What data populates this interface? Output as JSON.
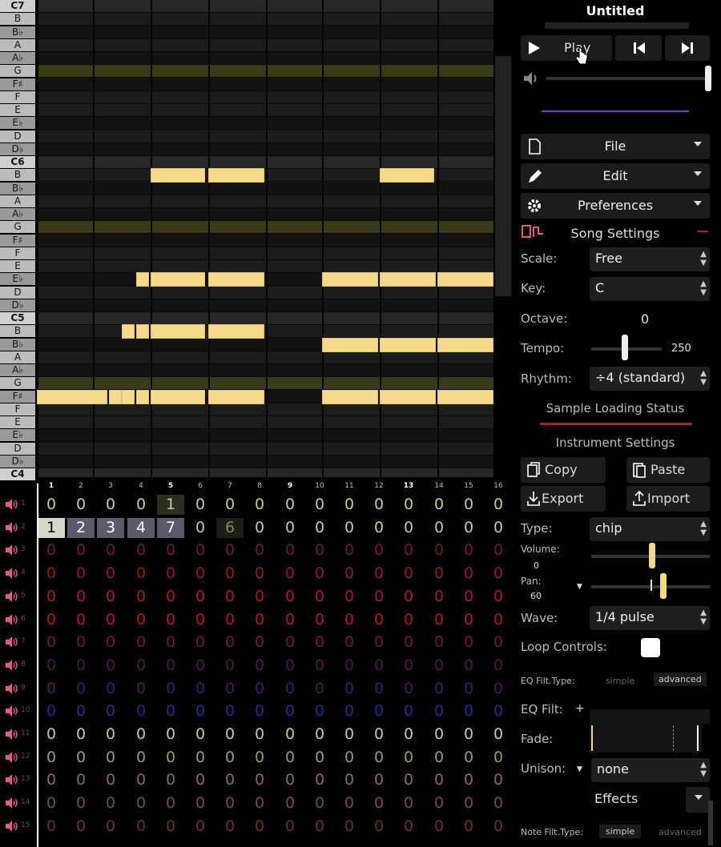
{
  "piano": {
    "keys": [
      {
        "label": "C7",
        "type": "oct"
      },
      {
        "label": "B",
        "type": "white"
      },
      {
        "label": "B♭",
        "type": "black"
      },
      {
        "label": "A",
        "type": "white"
      },
      {
        "label": "A♭",
        "type": "black"
      },
      {
        "label": "G",
        "type": "white"
      },
      {
        "label": "F♯",
        "type": "black"
      },
      {
        "label": "F",
        "type": "white"
      },
      {
        "label": "E",
        "type": "white"
      },
      {
        "label": "E♭",
        "type": "black"
      },
      {
        "label": "D",
        "type": "white"
      },
      {
        "label": "D♭",
        "type": "black"
      },
      {
        "label": "C6",
        "type": "oct"
      },
      {
        "label": "B",
        "type": "white"
      },
      {
        "label": "B♭",
        "type": "black"
      },
      {
        "label": "A",
        "type": "white"
      },
      {
        "label": "A♭",
        "type": "black"
      },
      {
        "label": "G",
        "type": "white"
      },
      {
        "label": "F♯",
        "type": "black"
      },
      {
        "label": "F",
        "type": "white"
      },
      {
        "label": "E",
        "type": "white"
      },
      {
        "label": "E♭",
        "type": "black"
      },
      {
        "label": "D",
        "type": "white"
      },
      {
        "label": "D♭",
        "type": "black"
      },
      {
        "label": "C5",
        "type": "oct"
      },
      {
        "label": "B",
        "type": "white"
      },
      {
        "label": "B♭",
        "type": "black"
      },
      {
        "label": "A",
        "type": "white"
      },
      {
        "label": "A♭",
        "type": "black"
      },
      {
        "label": "G",
        "type": "white"
      },
      {
        "label": "F♯",
        "type": "black"
      },
      {
        "label": "F",
        "type": "white"
      },
      {
        "label": "E",
        "type": "white"
      },
      {
        "label": "E♭",
        "type": "black"
      },
      {
        "label": "D",
        "type": "white"
      },
      {
        "label": "D♭",
        "type": "black"
      },
      {
        "label": "C4",
        "type": "oct"
      }
    ]
  },
  "pattern": {
    "bar_numbers": [
      "1",
      "2",
      "3",
      "4",
      "5",
      "6",
      "7",
      "8",
      "9",
      "10",
      "11",
      "12",
      "13",
      "14",
      "15",
      "16"
    ],
    "channels": [
      {
        "num": "1",
        "cells": [
          "0",
          "0",
          "0",
          "0",
          "1",
          "0",
          "0",
          "0",
          "0",
          "0",
          "0",
          "0",
          "0",
          "0",
          "0",
          "0"
        ],
        "color": "#c8c890"
      },
      {
        "num": "2",
        "cells": [
          "1",
          "2",
          "3",
          "4",
          "7",
          "0",
          "6",
          "0",
          "0",
          "0",
          "0",
          "0",
          "0",
          "0",
          "0",
          "0"
        ],
        "color": "#c8c890"
      },
      {
        "num": "3",
        "cells": [
          "0",
          "0",
          "0",
          "0",
          "0",
          "0",
          "0",
          "0",
          "0",
          "0",
          "0",
          "0",
          "0",
          "0",
          "0",
          "0"
        ],
        "color": "#6a2020"
      },
      {
        "num": "4",
        "cells": [
          "0",
          "0",
          "0",
          "0",
          "0",
          "0",
          "0",
          "0",
          "0",
          "0",
          "0",
          "0",
          "0",
          "0",
          "0",
          "0"
        ],
        "color": "#8a1c2a"
      },
      {
        "num": "5",
        "cells": [
          "0",
          "0",
          "0",
          "0",
          "0",
          "0",
          "0",
          "0",
          "0",
          "0",
          "0",
          "0",
          "0",
          "0",
          "0",
          "0"
        ],
        "color": "#a01c2e"
      },
      {
        "num": "6",
        "cells": [
          "0",
          "0",
          "0",
          "0",
          "0",
          "0",
          "0",
          "0",
          "0",
          "0",
          "0",
          "0",
          "0",
          "0",
          "0",
          "0"
        ],
        "color": "#b0182a"
      },
      {
        "num": "7",
        "cells": [
          "0",
          "0",
          "0",
          "0",
          "0",
          "0",
          "0",
          "0",
          "0",
          "0",
          "0",
          "0",
          "0",
          "0",
          "0",
          "0"
        ],
        "color": "#6a1c3a"
      },
      {
        "num": "8",
        "cells": [
          "0",
          "0",
          "0",
          "0",
          "0",
          "0",
          "0",
          "0",
          "0",
          "0",
          "0",
          "0",
          "0",
          "0",
          "0",
          "0"
        ],
        "color": "#4a1a4a"
      },
      {
        "num": "9",
        "cells": [
          "0",
          "0",
          "0",
          "0",
          "0",
          "0",
          "0",
          "0",
          "0",
          "0",
          "0",
          "0",
          "0",
          "0",
          "0",
          "0"
        ],
        "color": "#4a1a6a"
      },
      {
        "num": "10",
        "cells": [
          "0",
          "0",
          "0",
          "0",
          "0",
          "0",
          "0",
          "0",
          "0",
          "0",
          "0",
          "0",
          "0",
          "0",
          "0",
          "0"
        ],
        "color": "#2a2a8a"
      },
      {
        "num": "11",
        "cells": [
          "0",
          "0",
          "0",
          "0",
          "0",
          "0",
          "0",
          "0",
          "0",
          "0",
          "0",
          "0",
          "0",
          "0",
          "0",
          "0"
        ],
        "color": "#c8c890"
      },
      {
        "num": "12",
        "cells": [
          "0",
          "0",
          "0",
          "0",
          "0",
          "0",
          "0",
          "0",
          "0",
          "0",
          "0",
          "0",
          "0",
          "0",
          "0",
          "0"
        ],
        "color": "#a09870"
      },
      {
        "num": "13",
        "cells": [
          "0",
          "0",
          "0",
          "0",
          "0",
          "0",
          "0",
          "0",
          "0",
          "0",
          "0",
          "0",
          "0",
          "0",
          "0",
          "0"
        ],
        "color": "#8a6a5a"
      },
      {
        "num": "14",
        "cells": [
          "0",
          "0",
          "0",
          "0",
          "0",
          "0",
          "0",
          "0",
          "0",
          "0",
          "0",
          "0",
          "0",
          "0",
          "0",
          "0"
        ],
        "color": "#7a4a4a"
      },
      {
        "num": "15",
        "cells": [
          "0",
          "0",
          "0",
          "0",
          "0",
          "0",
          "0",
          "0",
          "0",
          "0",
          "0",
          "0",
          "0",
          "0",
          "0",
          "0"
        ],
        "color": "#6a3030"
      }
    ]
  },
  "panel": {
    "title": "Untitled",
    "play_label": "Play",
    "menus": {
      "file": "File",
      "edit": "Edit",
      "preferences": "Preferences"
    },
    "song_settings": "Song Settings",
    "scale_label": "Scale:",
    "scale_value": "Free",
    "key_label": "Key:",
    "key_value": "C",
    "octave_label": "Octave:",
    "octave_value": "0",
    "tempo_label": "Tempo:",
    "tempo_value": "250",
    "rhythm_label": "Rhythm:",
    "rhythm_value": "÷4 (standard)",
    "sample_status": "Sample Loading Status",
    "instrument_settings": "Instrument Settings",
    "copy_label": "Copy",
    "paste_label": "Paste",
    "export_label": "Export",
    "import_label": "Import",
    "type_label": "Type:",
    "type_value": "chip",
    "volume_label": "Volume:",
    "volume_value": "0",
    "pan_label": "Pan:",
    "pan_value": "60",
    "wave_label": "Wave:",
    "wave_value": "1/4 pulse",
    "loop_label": "Loop Controls:",
    "eq_type_label": "EQ Filt.Type:",
    "eq_simple": "simple",
    "eq_advanced": "advanced",
    "eq_filt_label": "EQ Filt:",
    "eq_add": "+",
    "fade_label": "Fade:",
    "unison_label": "Unison:",
    "unison_value": "none",
    "effects_label": "Effects",
    "note_type_label": "Note Filt.Type:",
    "note_simple": "simple",
    "note_advanced": "advanced"
  },
  "colors": {
    "note": "#f7d98a",
    "accent": "#e05a8a",
    "tonic_row": "#3a3a16"
  }
}
